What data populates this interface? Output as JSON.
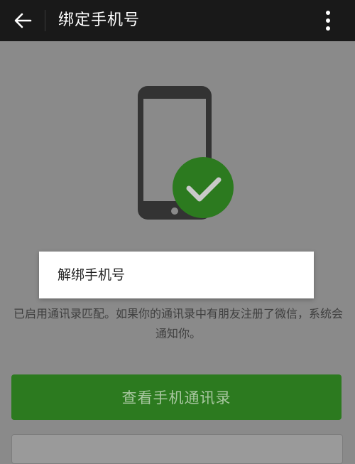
{
  "header": {
    "title": "绑定手机号",
    "back_icon": "arrow-left-icon",
    "more_icon": "more-vert-icon"
  },
  "illustration": {
    "phone_icon": "smartphone-icon",
    "check_icon": "check-circle-icon",
    "check_color": "#2c7a1f"
  },
  "menu": {
    "items": [
      {
        "label": "解绑手机号"
      }
    ]
  },
  "description": "已启用通讯录匹配。如果你的通讯录中有朋友注册了微信，系统会通知你。",
  "actions": {
    "primary_label": "查看手机通讯录"
  },
  "colors": {
    "topbar": "#191919",
    "overlay_background": "#8a8a8a",
    "primary_button": "#2c7a1f"
  }
}
